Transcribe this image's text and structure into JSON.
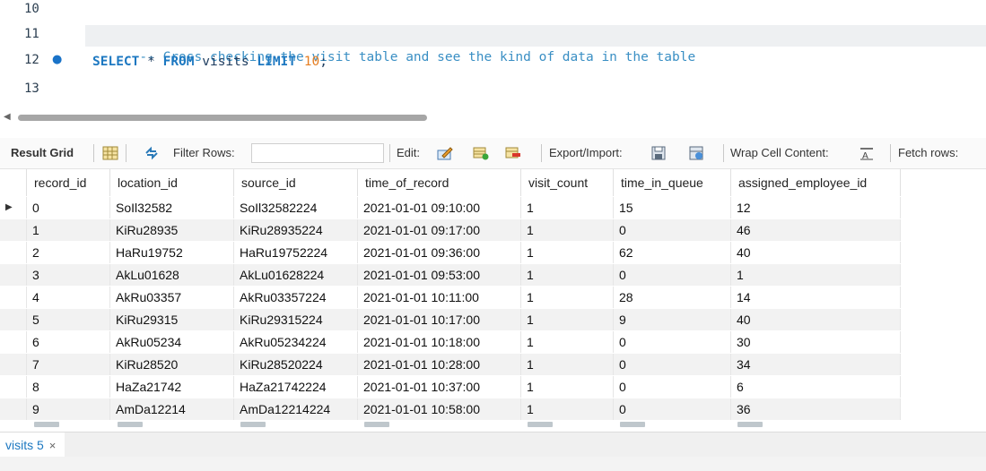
{
  "editor": {
    "lines": [
      {
        "num": "10",
        "tokens": []
      },
      {
        "num": "11",
        "tokens": [
          {
            "t": "comment",
            "v": "-- Cross checking the visit table and see the kind of data in the table"
          }
        ]
      },
      {
        "num": "12",
        "marker": true,
        "tokens": [
          {
            "t": "kw",
            "v": "SELECT"
          },
          {
            "t": "op",
            "v": " * "
          },
          {
            "t": "kw",
            "v": "FROM"
          },
          {
            "t": "id",
            "v": " visits "
          },
          {
            "t": "kw",
            "v": "LIMIT"
          },
          {
            "t": "op",
            "v": " "
          },
          {
            "t": "num",
            "v": "10"
          },
          {
            "t": "op",
            "v": ";"
          }
        ]
      },
      {
        "num": "13",
        "tokens": []
      }
    ]
  },
  "toolbar": {
    "result_grid": "Result Grid",
    "filter_rows": "Filter Rows:",
    "edit": "Edit:",
    "export_import": "Export/Import:",
    "wrap_cell": "Wrap Cell Content:",
    "fetch_rows": "Fetch rows:",
    "filter_value": ""
  },
  "grid": {
    "columns": [
      "record_id",
      "location_id",
      "source_id",
      "time_of_record",
      "visit_count",
      "time_in_queue",
      "assigned_employee_id"
    ],
    "rows": [
      [
        "0",
        "SoIl32582",
        "SoIl32582224",
        "2021-01-01 09:10:00",
        "1",
        "15",
        "12"
      ],
      [
        "1",
        "KiRu28935",
        "KiRu28935224",
        "2021-01-01 09:17:00",
        "1",
        "0",
        "46"
      ],
      [
        "2",
        "HaRu19752",
        "HaRu19752224",
        "2021-01-01 09:36:00",
        "1",
        "62",
        "40"
      ],
      [
        "3",
        "AkLu01628",
        "AkLu01628224",
        "2021-01-01 09:53:00",
        "1",
        "0",
        "1"
      ],
      [
        "4",
        "AkRu03357",
        "AkRu03357224",
        "2021-01-01 10:11:00",
        "1",
        "28",
        "14"
      ],
      [
        "5",
        "KiRu29315",
        "KiRu29315224",
        "2021-01-01 10:17:00",
        "1",
        "9",
        "40"
      ],
      [
        "6",
        "AkRu05234",
        "AkRu05234224",
        "2021-01-01 10:18:00",
        "1",
        "0",
        "30"
      ],
      [
        "7",
        "KiRu28520",
        "KiRu28520224",
        "2021-01-01 10:28:00",
        "1",
        "0",
        "34"
      ],
      [
        "8",
        "HaZa21742",
        "HaZa21742224",
        "2021-01-01 10:37:00",
        "1",
        "0",
        "6"
      ],
      [
        "9",
        "AmDa12214",
        "AmDa12214224",
        "2021-01-01 10:58:00",
        "1",
        "0",
        "36"
      ]
    ]
  },
  "result_tab": {
    "label": "visits 5",
    "close": "×"
  },
  "colors": {
    "accent": "#1d78c1",
    "comment": "#3a8fc4",
    "number": "#e67e22",
    "alt_row": "#f2f2f2"
  }
}
